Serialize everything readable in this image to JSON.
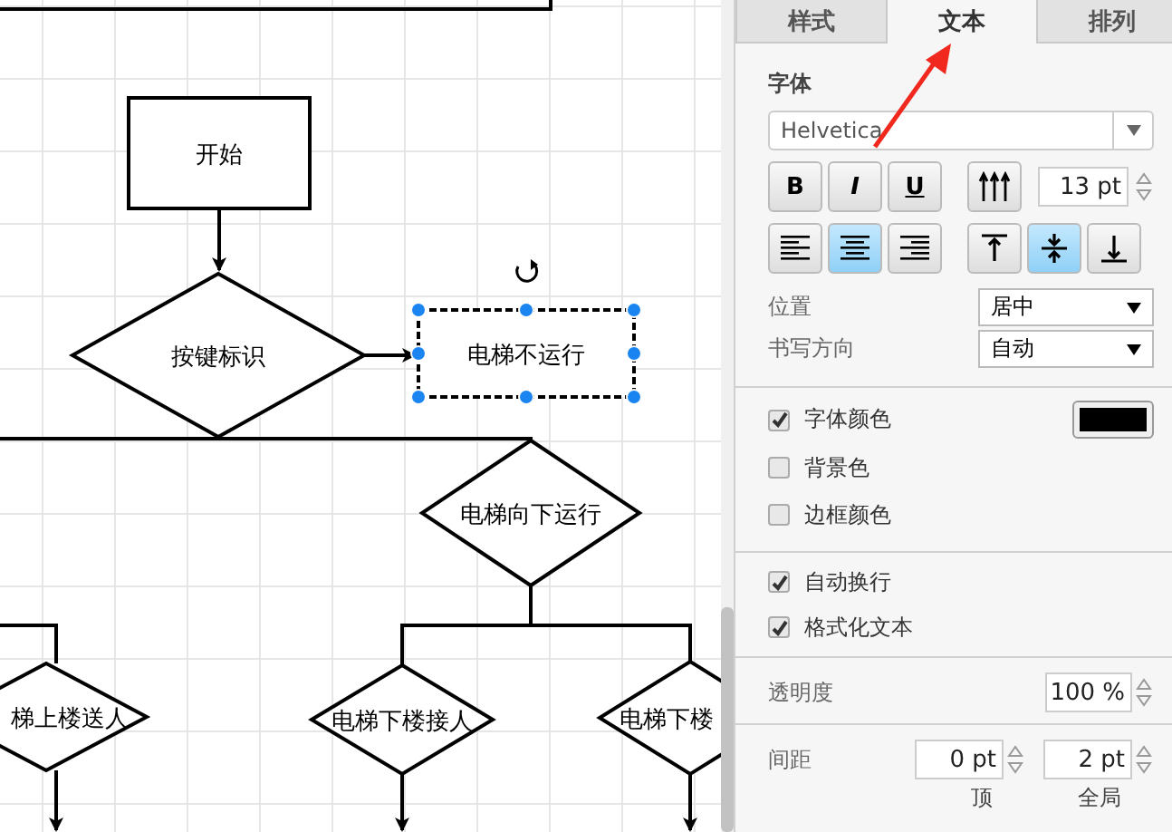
{
  "diagram": {
    "nodes": [
      {
        "kind": "rect",
        "text": "开始",
        "selected": false
      },
      {
        "kind": "diamond",
        "text": "按键标识",
        "selected": false
      },
      {
        "kind": "rect",
        "text": "电梯不运行",
        "selected": true
      },
      {
        "kind": "diamond",
        "text": "电梯向下运行",
        "selected": false
      },
      {
        "kind": "diamond",
        "text": "梯上楼送人",
        "selected": false
      },
      {
        "kind": "diamond",
        "text": "电梯下楼接人",
        "selected": false
      },
      {
        "kind": "diamond",
        "text": "电梯下楼",
        "selected": false
      }
    ]
  },
  "tabs": [
    {
      "label": "样式",
      "selected": false
    },
    {
      "label": "文本",
      "selected": true
    },
    {
      "label": "排列",
      "selected": false
    }
  ],
  "font": {
    "label": "字体",
    "value": "Helvetica"
  },
  "style_buttons": [
    {
      "glyph": "B",
      "kind": "bold"
    },
    {
      "glyph": "I",
      "kind": "italic"
    },
    {
      "glyph": "U",
      "kind": "underline"
    }
  ],
  "size": "13 pt",
  "align_buttons": [
    {
      "kind": "left",
      "selected": false
    },
    {
      "kind": "center",
      "selected": true
    },
    {
      "kind": "right",
      "selected": false
    }
  ],
  "valign_buttons": [
    {
      "kind": "top",
      "selected": false
    },
    {
      "kind": "middle",
      "selected": true
    },
    {
      "kind": "bottom",
      "selected": false
    }
  ],
  "selects": [
    {
      "label": "位置",
      "value": "居中"
    },
    {
      "label": "书写方向",
      "value": "自动"
    }
  ],
  "color_options": [
    {
      "label": "字体颜色",
      "checked": true,
      "color": "#000000"
    },
    {
      "label": "背景色",
      "checked": false
    },
    {
      "label": "边框颜色",
      "checked": false
    }
  ],
  "text_options": [
    {
      "label": "自动换行",
      "checked": true
    },
    {
      "label": "格式化文本",
      "checked": true
    }
  ],
  "opacity": {
    "label": "透明度",
    "value": "100 %"
  },
  "spacing": {
    "label": "间距",
    "fields": [
      {
        "value": "0 pt",
        "caption": "顶"
      },
      {
        "value": "2 pt",
        "caption": "全局"
      }
    ]
  }
}
